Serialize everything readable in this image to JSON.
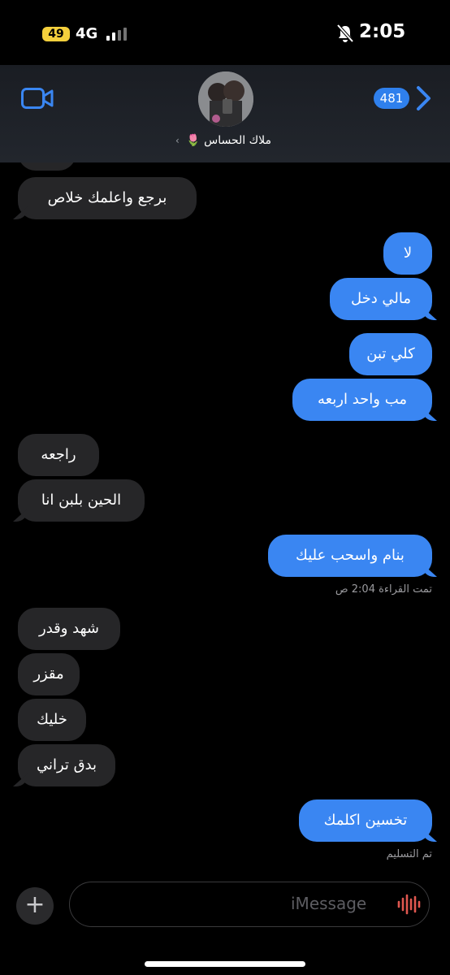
{
  "status_bar": {
    "battery": "49",
    "network": "4G",
    "time": "2:05"
  },
  "header": {
    "contact_name": "ملاك الحساس 🌷",
    "chevron": "›",
    "unread_count": "481",
    "icons": [
      "video-call-icon",
      "back-chevron-icon"
    ]
  },
  "messages": [
    {
      "side": "in",
      "text": "برجع واعلمك خلاص"
    },
    {
      "side": "out",
      "text": "لا"
    },
    {
      "side": "out",
      "text": "مالي دخل"
    },
    {
      "side": "out",
      "text": "كلي تبن"
    },
    {
      "side": "out",
      "text": "مب واحد اربعه"
    },
    {
      "side": "in",
      "text": "راجعه"
    },
    {
      "side": "in",
      "text": "الحين بلبن انا"
    },
    {
      "side": "out",
      "text": "بنام واسحب عليك"
    },
    {
      "side": "in",
      "text": "شهد وقدر"
    },
    {
      "side": "in",
      "text": "مقزر"
    },
    {
      "side": "in",
      "text": "خليك"
    },
    {
      "side": "in",
      "text": "بدق تراني"
    },
    {
      "side": "out",
      "text": "تخسين اكلمك"
    }
  ],
  "read_receipt": "تمت القراءة 2:04 ص",
  "delivered": "تم التسليم",
  "compose": {
    "placeholder": "iMessage",
    "plus": "+"
  },
  "colors": {
    "outgoing": "#3a86f2",
    "incoming": "#262628",
    "background": "#000000"
  }
}
